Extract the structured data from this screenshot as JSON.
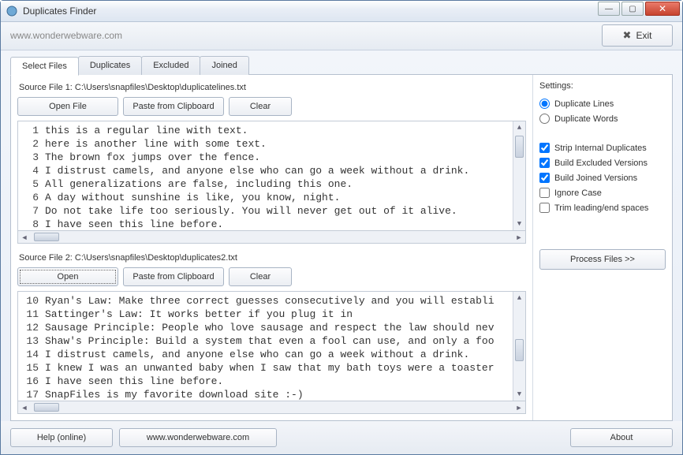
{
  "window": {
    "title": "Duplicates Finder"
  },
  "toolbar": {
    "url": "www.wonderwebware.com",
    "exit": "Exit"
  },
  "tabs": [
    "Select Files",
    "Duplicates",
    "Excluded",
    "Joined"
  ],
  "source1": {
    "label": "Source File 1: C:\\Users\\snapfiles\\Desktop\\duplicatelines.txt",
    "open": "Open File",
    "paste": "Paste from Clipboard",
    "clear": "Clear",
    "lines": [
      {
        "n": 1,
        "t": "this is a regular line with text."
      },
      {
        "n": 2,
        "t": "here is another line with some text."
      },
      {
        "n": 3,
        "t": "The brown fox jumps over the fence."
      },
      {
        "n": 4,
        "t": "I distrust camels, and anyone else who can go a week without a drink."
      },
      {
        "n": 5,
        "t": "All generalizations are false, including this one."
      },
      {
        "n": 6,
        "t": "A day without sunshine is like, you know, night."
      },
      {
        "n": 7,
        "t": "Do not take life too seriously. You will never get out of it alive."
      },
      {
        "n": 8,
        "t": "I have seen this line before."
      }
    ]
  },
  "source2": {
    "label": "Source File 2: C:\\Users\\snapfiles\\Desktop\\duplicates2.txt",
    "open": "Open",
    "paste": "Paste from Clipboard",
    "clear": "Clear",
    "lines": [
      {
        "n": 10,
        "t": "Ryan's Law: Make three correct guesses consecutively and you will establi"
      },
      {
        "n": 11,
        "t": "Sattinger's Law: It works better if you plug it in"
      },
      {
        "n": 12,
        "t": "Sausage Principle: People who love sausage and respect the law should nev"
      },
      {
        "n": 13,
        "t": "Shaw's Principle: Build a system that even a fool can use, and only a foo"
      },
      {
        "n": 14,
        "t": "I distrust camels, and anyone else who can go a week without a drink."
      },
      {
        "n": 15,
        "t": "I knew I was an unwanted baby when I saw that my bath toys were a toaster"
      },
      {
        "n": 16,
        "t": "I have seen this line before."
      },
      {
        "n": 17,
        "t": "SnapFiles is my favorite download site :-)"
      }
    ]
  },
  "settings": {
    "title": "Settings:",
    "radios": {
      "lines": "Duplicate Lines",
      "words": "Duplicate Words"
    },
    "checks": {
      "strip": "Strip Internal Duplicates",
      "excluded": "Build Excluded Versions",
      "joined": "Build Joined Versions",
      "ignore": "Ignore Case",
      "trim": "Trim leading/end spaces"
    },
    "process": "Process Files  >>"
  },
  "footer": {
    "help": "Help (online)",
    "site": "www.wonderwebware.com",
    "about": "About"
  }
}
